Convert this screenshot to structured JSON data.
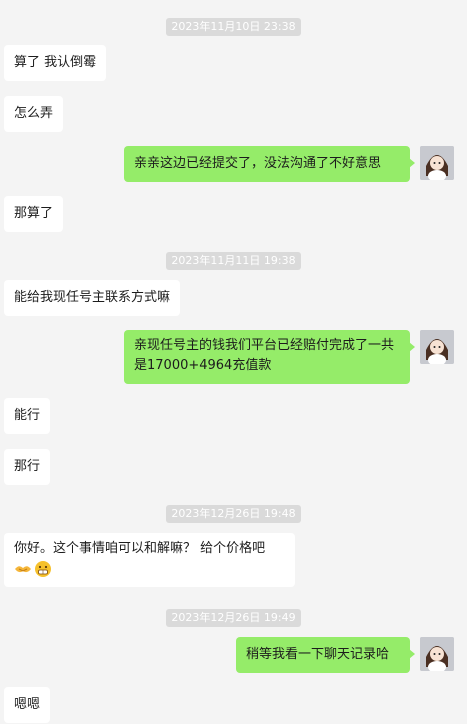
{
  "timestamps": [
    "2023年11月10日 23:38",
    "2023年11月11日 19:38",
    "2023年12月26日 19:48",
    "2023年12月26日 19:49"
  ],
  "messages": [
    {
      "side": "left",
      "text": "算了 我认倒霉"
    },
    {
      "side": "left",
      "text": "怎么弄"
    },
    {
      "side": "right",
      "text": "亲亲这边已经提交了，没法沟通了不好意思"
    },
    {
      "side": "left",
      "text": "那算了"
    },
    {
      "side": "left",
      "text": "能给我现任号主联系方式嘛"
    },
    {
      "side": "right",
      "text": "亲现任号主的钱我们平台已经赔付完成了一共是17000+4964充值款"
    },
    {
      "side": "left",
      "text": "能行"
    },
    {
      "side": "left",
      "text": "那行"
    },
    {
      "side": "left",
      "text": "你好。这个事情咱可以和解嘛？ 给个价格吧",
      "emojis": [
        "handshake-emoji",
        "grin-emoji"
      ]
    },
    {
      "side": "right",
      "text": "稍等我看一下聊天记录哈"
    },
    {
      "side": "left",
      "text": "嗯嗯"
    }
  ],
  "colors": {
    "background": "#f4f4f4",
    "incoming_bubble": "#ffffff",
    "outgoing_bubble": "#95ec69",
    "timestamp_bg": "#dadada"
  }
}
